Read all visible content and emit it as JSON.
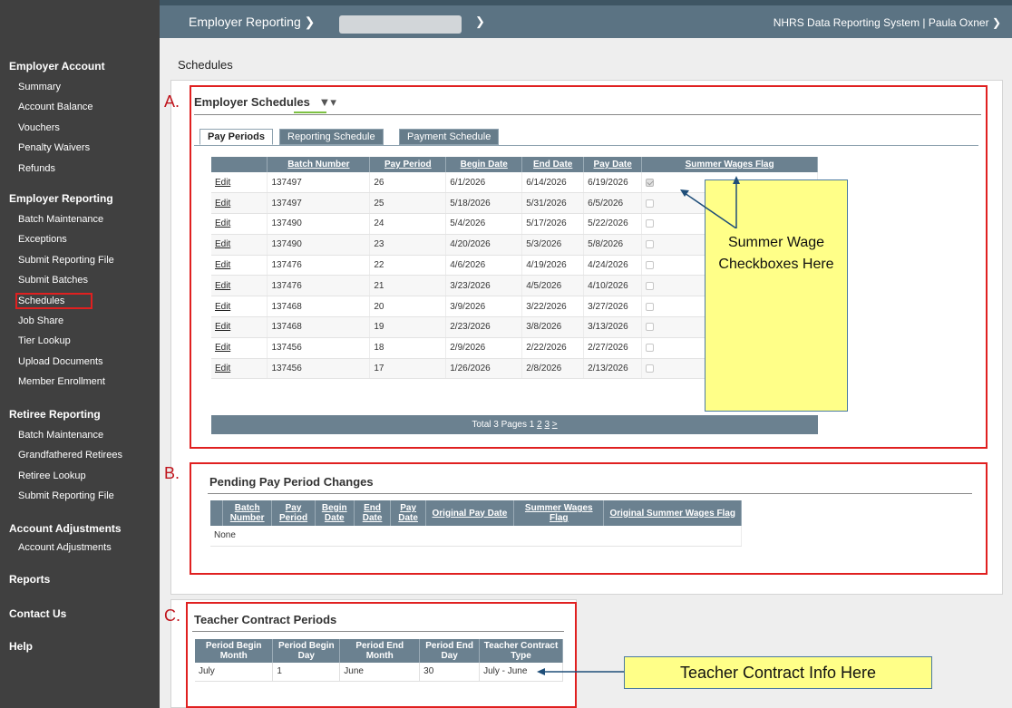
{
  "topbar": {
    "menu_label": "Employer Reporting",
    "right_text": "NHRS Data Reporting System  |  Paula Oxner"
  },
  "sidebar": {
    "sections": [
      {
        "title": "Employer Account",
        "items": [
          "Summary",
          "Account Balance",
          "Vouchers",
          "Penalty Waivers",
          "Refunds"
        ]
      },
      {
        "title": "Employer Reporting",
        "items": [
          "Batch Maintenance",
          "Exceptions",
          "Submit Reporting File",
          "Submit Batches",
          "Schedules",
          "Job Share",
          "Tier Lookup",
          "Upload Documents",
          "Member Enrollment"
        ]
      },
      {
        "title": "Retiree Reporting",
        "items": [
          "Batch Maintenance",
          "Grandfathered Retirees",
          "Retiree Lookup",
          "Submit Reporting File"
        ]
      },
      {
        "title": "Account Adjustments",
        "items": [
          "Account Adjustments"
        ]
      },
      {
        "title": "Reports",
        "items": []
      },
      {
        "title": "Contact Us",
        "items": []
      },
      {
        "title": "Help",
        "items": []
      }
    ]
  },
  "page": {
    "title": "Schedules"
  },
  "labels": {
    "a": "A.",
    "b": "B.",
    "c": "C."
  },
  "employer_schedules": {
    "title": "Employer Schedules",
    "tabs": [
      "Pay Periods",
      "Reporting Schedule",
      "Payment Schedule"
    ],
    "headers": [
      "Batch Number",
      "Pay Period",
      "Begin Date",
      "End Date",
      "Pay Date",
      "Summer Wages Flag"
    ],
    "edit_label": "Edit",
    "rows": [
      {
        "batch": "137497",
        "period": "26",
        "begin": "6/1/2026",
        "end": "6/14/2026",
        "pay": "6/19/2026",
        "flag": true
      },
      {
        "batch": "137497",
        "period": "25",
        "begin": "5/18/2026",
        "end": "5/31/2026",
        "pay": "6/5/2026",
        "flag": false
      },
      {
        "batch": "137490",
        "period": "24",
        "begin": "5/4/2026",
        "end": "5/17/2026",
        "pay": "5/22/2026",
        "flag": false
      },
      {
        "batch": "137490",
        "period": "23",
        "begin": "4/20/2026",
        "end": "5/3/2026",
        "pay": "5/8/2026",
        "flag": false
      },
      {
        "batch": "137476",
        "period": "22",
        "begin": "4/6/2026",
        "end": "4/19/2026",
        "pay": "4/24/2026",
        "flag": false
      },
      {
        "batch": "137476",
        "period": "21",
        "begin": "3/23/2026",
        "end": "4/5/2026",
        "pay": "4/10/2026",
        "flag": false
      },
      {
        "batch": "137468",
        "period": "20",
        "begin": "3/9/2026",
        "end": "3/22/2026",
        "pay": "3/27/2026",
        "flag": false
      },
      {
        "batch": "137468",
        "period": "19",
        "begin": "2/23/2026",
        "end": "3/8/2026",
        "pay": "3/13/2026",
        "flag": false
      },
      {
        "batch": "137456",
        "period": "18",
        "begin": "2/9/2026",
        "end": "2/22/2026",
        "pay": "2/27/2026",
        "flag": false
      },
      {
        "batch": "137456",
        "period": "17",
        "begin": "1/26/2026",
        "end": "2/8/2026",
        "pay": "2/13/2026",
        "flag": false
      }
    ],
    "pager_text": "Total 3 Pages  1",
    "pager_links": [
      "2",
      "3",
      ">"
    ]
  },
  "callout_summer": "Summer Wage Checkboxes Here",
  "pending": {
    "title": "Pending Pay Period Changes",
    "headers": [
      "Batch Number",
      "Pay Period",
      "Begin Date",
      "End Date",
      "Pay Date",
      "Original Pay Date",
      "Summer Wages Flag",
      "Original Summer Wages Flag"
    ],
    "empty_text": "None"
  },
  "teacher": {
    "title": "Teacher Contract Periods",
    "headers": [
      "Period Begin Month",
      "Period Begin Day",
      "Period End Month",
      "Period End Day",
      "Teacher Contract Type"
    ],
    "row": [
      "July",
      "1",
      "June",
      "30",
      "July - June"
    ]
  },
  "callout_teacher": "Teacher Contract Info Here",
  "colors": {
    "sidebar": "#404040",
    "topbar": "#5b7383",
    "grid_header": "#6b8190",
    "highlight": "#e02020",
    "callout": "#ffff88"
  }
}
